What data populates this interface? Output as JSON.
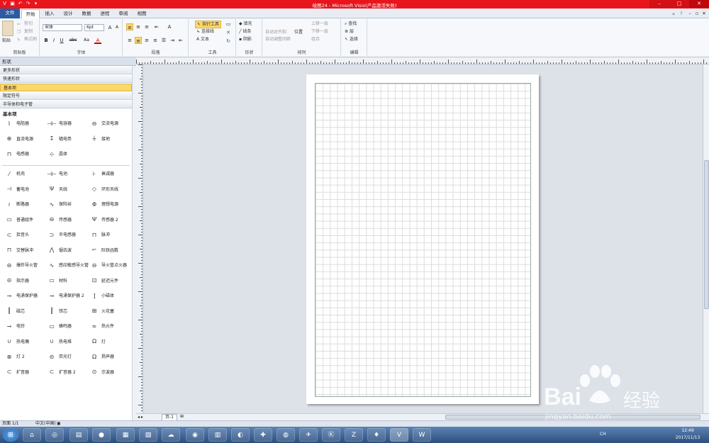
{
  "window": {
    "title": "绘图24 - Microsoft Visio(产品激活失败)"
  },
  "tabs": [
    "文件",
    "开始",
    "插入",
    "设计",
    "数据",
    "进程",
    "审阅",
    "视图"
  ],
  "ribbon": {
    "clipboard": {
      "label": "剪贴板",
      "paste": "粘贴",
      "cut": "剪切",
      "copy": "复制",
      "format_painter": "格式刷"
    },
    "font": {
      "label": "字体",
      "font_name": "宋体",
      "font_size": "6pt",
      "bold": "B",
      "italic": "I",
      "underline": "U",
      "abc": "abc",
      "aa": "Aa",
      "color_a": "A"
    },
    "paragraph": {
      "label": "段落"
    },
    "tools": {
      "label": "工具",
      "pointer": "指针工具",
      "connector": "连接线",
      "text": "文本"
    },
    "shape": {
      "label": "形状",
      "fill": "填充",
      "line": "线条",
      "shadow": "阴影"
    },
    "arrange": {
      "label": "排列",
      "auto_align": "自动对齐和",
      "auto_space": "自动调整间距",
      "position": "位置",
      "bring_forward": "上移一层",
      "send_backward": "下移一层",
      "group": "组合"
    },
    "editing": {
      "label": "编辑",
      "find": "查找",
      "layers": "层",
      "select": "选择"
    }
  },
  "sidebar": {
    "header": "形状",
    "stencils": [
      "更多形状",
      "快速形状",
      "基本项",
      "限定符号",
      "半导体和电子管"
    ],
    "section_title": "基本项",
    "shapes_group1": [
      "电阻器",
      "电容器",
      "交流电源",
      "直流电源",
      "辐电势",
      "接地",
      "电感器",
      "晶体"
    ],
    "shapes_group2": [
      "机壳",
      "电池",
      "衰减器",
      "蓄电池",
      "天线",
      "环形天线",
      "断路器",
      "保险丝",
      "理想电源",
      "普通组件",
      "传感器",
      "传感器 2",
      "拾音头",
      "半电感器",
      "脉冲",
      "交替脉冲",
      "锯齿波",
      "阶跃函数",
      "爆炸导火管",
      "感应敏感导火管",
      "导火管点火器",
      "指示器",
      "材料",
      "延迟元件",
      "电涌保护器",
      "电涌保护器 2",
      "小磁体",
      "磁芯",
      "铁芯",
      "火花塞",
      "电铃",
      "蜂鸣器",
      "热元件",
      "热电偶",
      "热电堆",
      "灯",
      "灯 2",
      "荧光灯",
      "扬声器",
      "扩音器",
      "扩音器 2",
      "示波器"
    ]
  },
  "canvas": {
    "page_tab": "页-1"
  },
  "statusbar": {
    "page": "页面 1/1",
    "lang": "中文(中国)"
  },
  "taskbar": {
    "time": "12:49",
    "date": "2017/11/13",
    "lang": "CH"
  },
  "watermark": {
    "brand": "Bai",
    "suffix": "经验",
    "url": "jingyan.baidu.com"
  }
}
